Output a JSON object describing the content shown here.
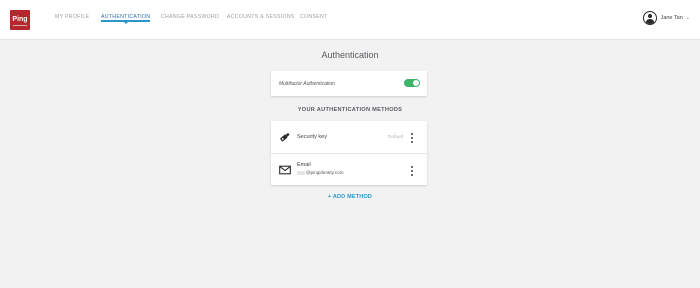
{
  "brand": {
    "logo_text": "Ping",
    "accent_color": "#b3282d"
  },
  "nav": {
    "items": [
      {
        "label": "MY PROFILE",
        "active": false
      },
      {
        "label": "AUTHENTICATION",
        "active": true
      },
      {
        "label": "CHANGE PASSWORD",
        "active": false
      },
      {
        "label": "ACCOUNTS & SESSIONS",
        "active": false
      },
      {
        "label": "CONSENT",
        "active": false
      }
    ],
    "active_color": "#2996cc"
  },
  "user": {
    "name": "Jane Tan",
    "icon": "user-avatar-icon",
    "caret": "⌄"
  },
  "page": {
    "title": "Authentication"
  },
  "mfa": {
    "label": "Multifactor Authentication",
    "enabled": true,
    "toggle_color": "#3db468"
  },
  "methods_section": {
    "title": "YOUR AUTHENTICATION METHODS",
    "methods": [
      {
        "name": "Security key",
        "detail": "",
        "badge": "Default",
        "icon": "security-key-icon"
      },
      {
        "name": "Email",
        "detail": "@pingidentity.com",
        "badge": "",
        "icon": "envelope-icon"
      }
    ]
  },
  "add_method": {
    "label": "+ ADD METHOD"
  }
}
